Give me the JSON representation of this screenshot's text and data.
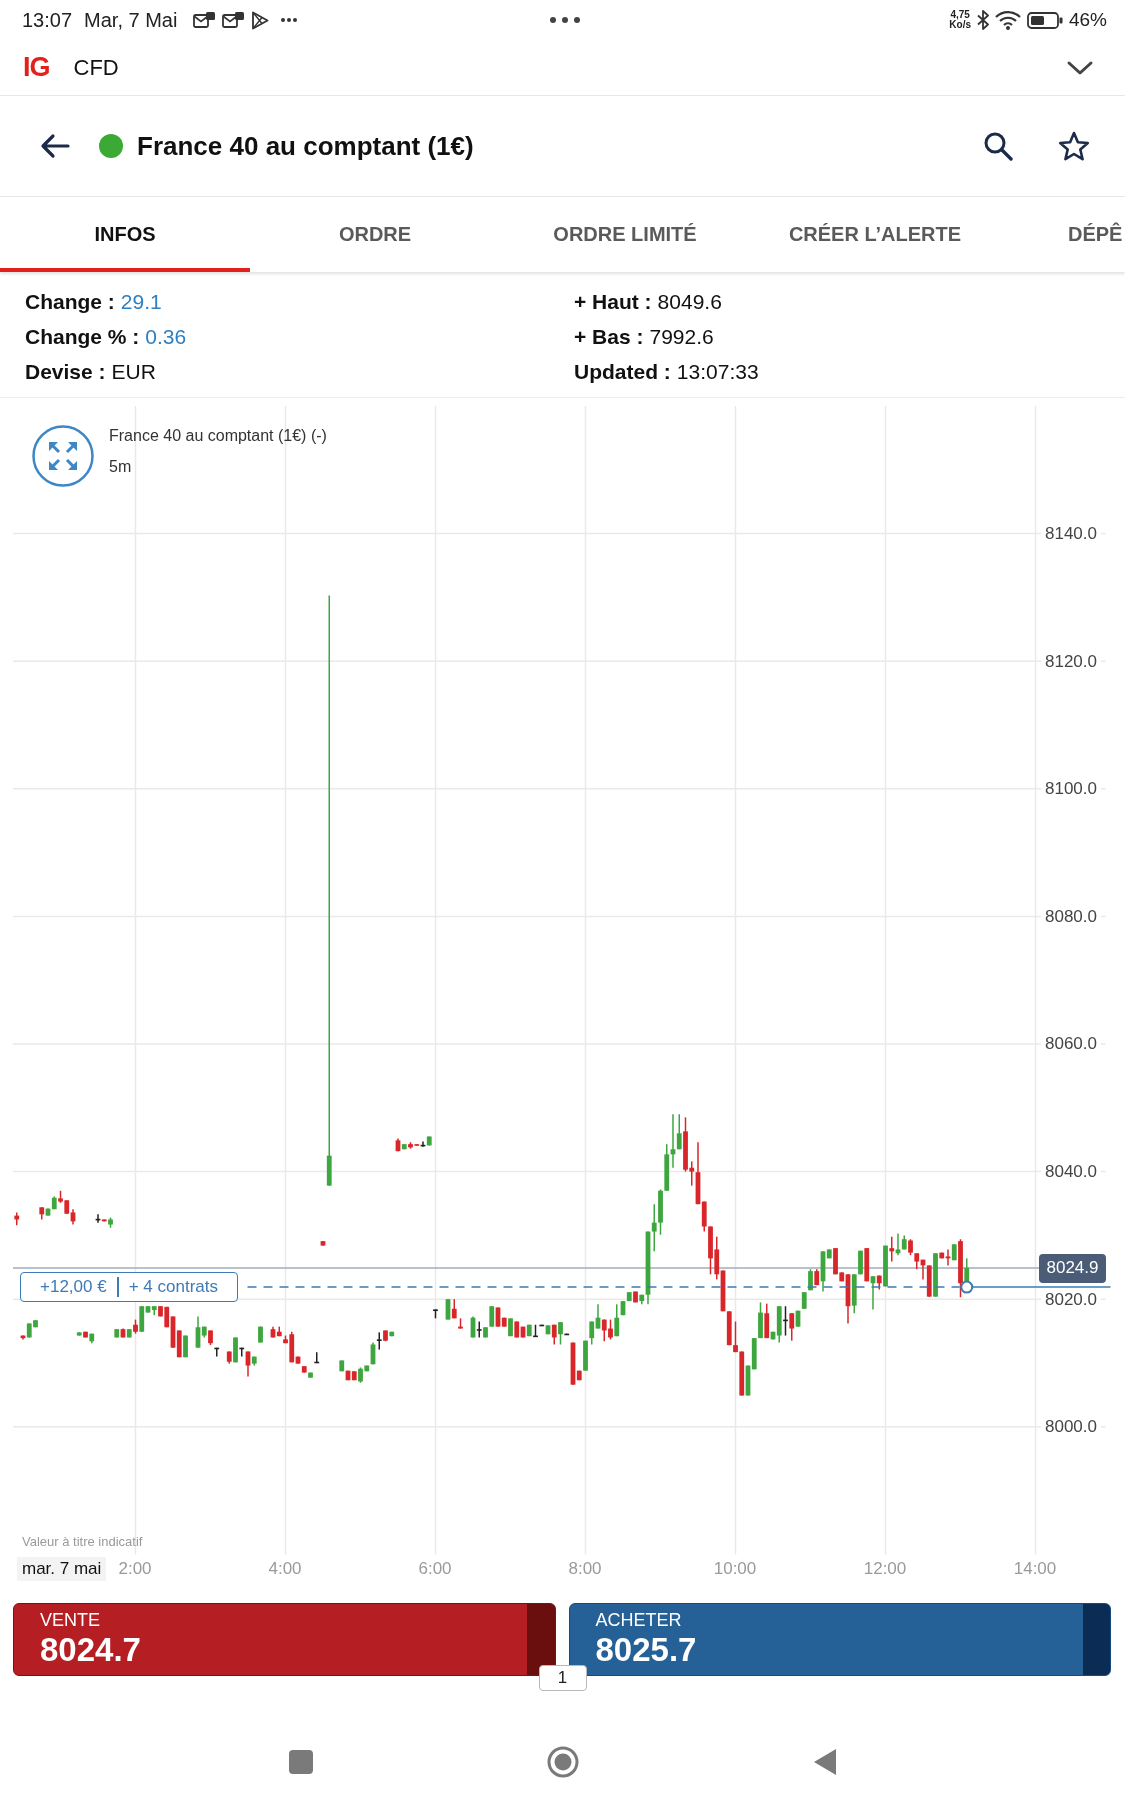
{
  "status_bar": {
    "time": "13:07",
    "date": "Mar, 7 Mai",
    "network_speed": "4,75",
    "network_unit": "Ko/s",
    "battery": "46%"
  },
  "app_bar": {
    "logo": "IG",
    "title": "CFD"
  },
  "market_header": {
    "title": "France 40 au comptant (1€)",
    "market_open": true
  },
  "tabs": [
    {
      "label": "INFOS",
      "selected": true
    },
    {
      "label": "ORDRE",
      "selected": false
    },
    {
      "label": "ORDRE LIMITÉ",
      "selected": false
    },
    {
      "label": "CRÉER L’ALERTE",
      "selected": false
    },
    {
      "label": "DÉPÊ",
      "selected": false
    }
  ],
  "info": [
    {
      "label": "Change :",
      "value": "29.1",
      "kind": "change"
    },
    {
      "label": "+ Haut :",
      "value": "8049.6",
      "kind": "plain"
    },
    {
      "label": "Change % :",
      "value": "0.36",
      "kind": "change"
    },
    {
      "label": "+ Bas :",
      "value": "7992.6",
      "kind": "plain"
    },
    {
      "label": "Devise :",
      "value": "EUR",
      "kind": "plain"
    },
    {
      "label": "Updated :",
      "value": "13:07:33",
      "kind": "plain"
    }
  ],
  "chart": {
    "interval": "5m",
    "date_label": "mar. 7 mai",
    "disclaimer": "Valeur à titre indicatif",
    "position": {
      "pnl": "+12,00 €",
      "contracts": "+ 4 contrats"
    },
    "chart_data": {
      "type": "candlestick",
      "title": "France 40 au comptant (1€) (-)",
      "grid": true,
      "xlim": [
        22,
        896
      ],
      "ylim": [
        7980,
        8160
      ],
      "yticks": [
        {
          "value": 8140,
          "label": "8140.0"
        },
        {
          "value": 8120,
          "label": "8120.0"
        },
        {
          "value": 8100,
          "label": "8100.0"
        },
        {
          "value": 8080,
          "label": "8080.0"
        },
        {
          "value": 8060,
          "label": "8060.0"
        },
        {
          "value": 8040,
          "label": "8040.0"
        },
        {
          "value": 8020,
          "label": "8020.0"
        },
        {
          "value": 8000,
          "label": "8000.0"
        }
      ],
      "xticks": [
        {
          "value": 120,
          "label": "2:00"
        },
        {
          "value": 240,
          "label": "4:00"
        },
        {
          "value": 360,
          "label": "6:00"
        },
        {
          "value": 480,
          "label": "8:00"
        },
        {
          "value": 600,
          "label": "10:00"
        },
        {
          "value": 720,
          "label": "12:00"
        },
        {
          "value": 840,
          "label": "14:00"
        }
      ],
      "ref_lines": [
        {
          "axis": "y",
          "value": 8024.9,
          "label": "8024.9",
          "color": "#a3acba"
        },
        {
          "axis": "y",
          "value": 8021.9,
          "color": "#3d7ab8"
        }
      ],
      "x": [
        25,
        30,
        35,
        40,
        45,
        50,
        55,
        60,
        65,
        70,
        75,
        80,
        85,
        90,
        95,
        100,
        105,
        110,
        115,
        120,
        125,
        130,
        135,
        140,
        145,
        150,
        155,
        160,
        170,
        175,
        180,
        185,
        195,
        200,
        205,
        210,
        215,
        220,
        230,
        235,
        240,
        245,
        250,
        255,
        260,
        265,
        270,
        275,
        285,
        290,
        295,
        300,
        305,
        310,
        315,
        320,
        325,
        330,
        335,
        340,
        345,
        350,
        355,
        360,
        370,
        375,
        380,
        390,
        395,
        400,
        405,
        410,
        415,
        420,
        425,
        430,
        435,
        440,
        445,
        450,
        455,
        460,
        465,
        470,
        475,
        480,
        485,
        490,
        495,
        500,
        505,
        510,
        515,
        520,
        525,
        530,
        535,
        540,
        545,
        550,
        555,
        560,
        565,
        570,
        575,
        580,
        585,
        590,
        595,
        600,
        605,
        610,
        615,
        620,
        625,
        630,
        635,
        640,
        645,
        650,
        655,
        660,
        665,
        670,
        675,
        680,
        685,
        690,
        695,
        700,
        705,
        710,
        715,
        720,
        725,
        730,
        735,
        740,
        745,
        750,
        755,
        760,
        765,
        770,
        775,
        780,
        785
      ],
      "ohlc": [
        [
          8033.1,
          8033.6,
          8031.6,
          8032.5
        ],
        [
          8014.3,
          8014.3,
          8013.7,
          8013.9
        ],
        [
          8014.0,
          8016.2,
          8014.0,
          8016.2
        ],
        [
          8015.6,
          8016.7,
          8015.6,
          8016.7
        ],
        [
          8034.4,
          8034.4,
          8032.5,
          8033.3
        ],
        [
          8033.1,
          8034.2,
          8033.1,
          8034.2
        ],
        [
          8034.1,
          8036.1,
          8034.1,
          8035.9
        ],
        [
          8035.8,
          8037.0,
          8035.1,
          8035.3
        ],
        [
          8035.5,
          8035.5,
          8033.4,
          8033.4
        ],
        [
          8033.6,
          8034.1,
          8031.7,
          8032.2
        ],
        [
          8014.3,
          8014.8,
          8014.3,
          8014.8
        ],
        [
          8014.9,
          8014.9,
          8014.0,
          8014.0
        ],
        [
          8013.4,
          8014.6,
          8013.1,
          8014.6
        ],
        [
          8032.6,
          8033.3,
          8032.0,
          8032.6
        ],
        [
          8032.5,
          8032.5,
          8032.2,
          8032.2
        ],
        [
          8031.7,
          8032.8,
          8031.2,
          8032.5
        ],
        [
          8014.0,
          8015.3,
          8014.0,
          8015.3
        ],
        [
          8015.3,
          8015.4,
          8014.0,
          8014.0
        ],
        [
          8014.0,
          8015.3,
          8014.0,
          8015.3
        ],
        [
          8016.0,
          8016.8,
          8014.6,
          8014.9
        ],
        [
          8014.9,
          8018.9,
          8014.9,
          8018.9
        ],
        [
          8017.9,
          8018.9,
          8017.9,
          8018.9
        ],
        [
          8018.3,
          8018.9,
          8017.5,
          8018.9
        ],
        [
          8018.9,
          8018.9,
          8017.3,
          8017.3
        ],
        [
          8018.8,
          8018.8,
          8015.6,
          8015.6
        ],
        [
          8017.3,
          8017.3,
          8012.4,
          8012.4
        ],
        [
          8015.1,
          8015.1,
          8010.9,
          8010.9
        ],
        [
          8010.9,
          8014.3,
          8010.9,
          8014.3
        ],
        [
          8012.4,
          8017.3,
          8012.4,
          8015.6
        ],
        [
          8014.3,
          8015.7,
          8014.0,
          8015.7
        ],
        [
          8015.1,
          8015.1,
          8012.8,
          8013.1
        ],
        [
          8012.4,
          8012.4,
          8011.0,
          8012.4
        ],
        [
          8011.8,
          8011.8,
          8009.9,
          8010.2
        ],
        [
          8010.1,
          8014.0,
          8010.1,
          8014.0
        ],
        [
          8012.4,
          8012.4,
          8011.0,
          8012.4
        ],
        [
          8011.8,
          8011.8,
          8007.9,
          8009.6
        ],
        [
          8009.9,
          8011.0,
          8009.6,
          8011.0
        ],
        [
          8013.2,
          8015.7,
          8013.2,
          8015.7
        ],
        [
          8015.3,
          8015.7,
          8014.0,
          8014.0
        ],
        [
          8014.9,
          8015.7,
          8014.2,
          8014.2
        ],
        [
          8013.7,
          8014.3,
          8013.1,
          8013.1
        ],
        [
          8014.5,
          8014.9,
          8010.1,
          8010.1
        ],
        [
          8011.0,
          8011.0,
          8009.9,
          8009.9
        ],
        [
          8009.5,
          8009.5,
          8008.5,
          8008.5
        ],
        [
          8007.7,
          8008.5,
          8007.7,
          8008.5
        ],
        [
          8010.2,
          8011.7,
          8010.1,
          8010.2
        ],
        [
          8029.1,
          8029.1,
          8028.4,
          8028.4
        ],
        [
          8037.8,
          8130.3,
          8037.8,
          8042.5
        ],
        [
          8008.7,
          8010.4,
          8008.7,
          8010.4
        ],
        [
          8008.8,
          8008.8,
          8007.3,
          8007.3
        ],
        [
          8008.7,
          8008.7,
          8007.3,
          8007.3
        ],
        [
          8007.1,
          8009.3,
          8006.9,
          8009.1
        ],
        [
          8008.7,
          8009.6,
          8008.7,
          8009.6
        ],
        [
          8009.8,
          8013.2,
          8009.8,
          8012.9
        ],
        [
          8013.7,
          8014.8,
          8012.1,
          8013.7
        ],
        [
          8015.1,
          8015.1,
          8013.4,
          8013.5
        ],
        [
          8014.2,
          8014.9,
          8014.2,
          8014.9
        ],
        [
          8044.9,
          8045.2,
          8043.2,
          8043.2
        ],
        [
          8043.5,
          8044.3,
          8043.5,
          8044.3
        ],
        [
          8044.3,
          8044.6,
          8043.6,
          8043.8
        ],
        [
          8044.3,
          8044.3,
          8044.1,
          8044.1
        ],
        [
          8044.2,
          8044.7,
          8043.9,
          8044.2
        ],
        [
          8044.1,
          8045.5,
          8044.1,
          8045.5
        ],
        [
          8018.4,
          8018.4,
          8017.0,
          8018.4
        ],
        [
          8016.8,
          8020.0,
          8016.8,
          8020.0
        ],
        [
          8018.5,
          8020.0,
          8017.0,
          8017.0
        ],
        [
          8015.7,
          8017.0,
          8015.4,
          8015.4
        ],
        [
          8014.0,
          8017.3,
          8014.0,
          8017.1
        ],
        [
          8015.3,
          8016.5,
          8014.0,
          8015.3
        ],
        [
          8014.0,
          8015.6,
          8014.0,
          8015.6
        ],
        [
          8015.7,
          8018.9,
          8015.7,
          8018.9
        ],
        [
          8018.7,
          8018.7,
          8015.7,
          8015.7
        ],
        [
          8017.1,
          8017.1,
          8015.7,
          8015.7
        ],
        [
          8014.2,
          8017.0,
          8014.2,
          8017.0
        ],
        [
          8016.5,
          8016.5,
          8014.0,
          8014.0
        ],
        [
          8015.7,
          8015.7,
          8014.0,
          8014.0
        ],
        [
          8014.2,
          8016.0,
          8014.2,
          8016.0
        ],
        [
          8014.3,
          8016.0,
          8014.2,
          8014.3
        ],
        [
          8016.0,
          8016.0,
          8015.9,
          8016.0
        ],
        [
          8014.5,
          8015.9,
          8014.5,
          8015.9
        ],
        [
          8016.0,
          8016.0,
          8012.9,
          8014.0
        ],
        [
          8014.5,
          8016.4,
          8012.9,
          8016.4
        ],
        [
          8014.6,
          8014.6,
          8014.5,
          8014.6
        ],
        [
          8013.2,
          8013.2,
          8006.6,
          8006.6
        ],
        [
          8008.8,
          8008.8,
          8007.3,
          8007.3
        ],
        [
          8008.8,
          8013.5,
          8008.8,
          8013.5
        ],
        [
          8013.9,
          8016.5,
          8012.9,
          8016.5
        ],
        [
          8015.4,
          8019.2,
          8015.4,
          8017.1
        ],
        [
          8016.8,
          8016.8,
          8013.4,
          8015.1
        ],
        [
          8015.4,
          8016.8,
          8013.7,
          8014.0
        ],
        [
          8014.2,
          8019.2,
          8014.2,
          8017.1
        ],
        [
          8017.5,
          8019.7,
          8017.5,
          8019.7
        ],
        [
          8019.7,
          8021.1,
          8019.7,
          8021.1
        ],
        [
          8021.2,
          8021.2,
          8019.5,
          8019.5
        ],
        [
          8019.7,
          8020.7,
          8019.2,
          8020.7
        ],
        [
          8020.7,
          8030.6,
          8019.2,
          8030.6
        ],
        [
          8030.6,
          8034.9,
          8027.5,
          8032.0
        ],
        [
          8032.0,
          8037.2,
          8030.1,
          8037.0
        ],
        [
          8037.0,
          8044.3,
          8037.0,
          8042.7
        ],
        [
          8042.7,
          8049.0,
          8040.6,
          8043.5
        ],
        [
          8043.5,
          8049.0,
          8043.5,
          8046.0
        ],
        [
          8046.3,
          8048.5,
          8040.0,
          8040.3
        ],
        [
          8040.6,
          8041.6,
          8037.8,
          8040.0
        ],
        [
          8039.9,
          8044.6,
          8034.9,
          8034.9
        ],
        [
          8035.3,
          8035.3,
          8030.6,
          8031.4
        ],
        [
          8031.4,
          8031.4,
          8023.9,
          8026.4
        ],
        [
          8027.8,
          8029.8,
          8023.1,
          8023.9
        ],
        [
          8024.5,
          8024.5,
          8018.1,
          8018.1
        ],
        [
          8018.1,
          8018.1,
          8012.8,
          8012.8
        ],
        [
          8012.8,
          8016.5,
          8011.7,
          8011.7
        ],
        [
          8011.8,
          8011.8,
          8004.9,
          8004.9
        ],
        [
          8004.9,
          8009.6,
          8004.9,
          8009.6
        ],
        [
          8009.0,
          8013.9,
          8009.0,
          8013.9
        ],
        [
          8013.9,
          8019.5,
          8013.9,
          8017.9
        ],
        [
          8017.8,
          8019.3,
          8013.9,
          8013.9
        ],
        [
          8013.7,
          8014.9,
          8013.7,
          8014.9
        ],
        [
          8014.3,
          8018.9,
          8013.2,
          8018.9
        ],
        [
          8016.8,
          8018.9,
          8014.3,
          8016.8
        ],
        [
          8017.8,
          8017.8,
          8013.5,
          8015.4
        ],
        [
          8015.7,
          8018.2,
          8015.7,
          8018.2
        ],
        [
          8018.5,
          8021.1,
          8018.5,
          8021.1
        ],
        [
          8021.4,
          8024.7,
          8021.4,
          8024.4
        ],
        [
          8024.4,
          8024.7,
          8022.2,
          8022.2
        ],
        [
          8022.8,
          8027.5,
          8021.2,
          8027.5
        ],
        [
          8026.4,
          8027.8,
          8026.4,
          8027.8
        ],
        [
          8028.0,
          8028.0,
          8023.9,
          8023.9
        ],
        [
          8024.2,
          8024.2,
          8022.8,
          8022.8
        ],
        [
          8023.9,
          8023.9,
          8016.2,
          8018.9
        ],
        [
          8019.0,
          8023.9,
          8017.8,
          8023.9
        ],
        [
          8023.9,
          8027.6,
          8023.9,
          8027.6
        ],
        [
          8028.0,
          8028.0,
          8022.8,
          8022.8
        ],
        [
          8022.5,
          8023.6,
          8018.4,
          8023.6
        ],
        [
          8023.7,
          8023.7,
          8021.5,
          8022.5
        ],
        [
          8022.0,
          8028.4,
          8022.0,
          8028.4
        ],
        [
          8028.0,
          8029.8,
          8025.9,
          8027.5
        ],
        [
          8027.2,
          8030.3,
          8026.9,
          8027.8
        ],
        [
          8027.8,
          8030.0,
          8027.8,
          8029.4
        ],
        [
          8029.2,
          8029.4,
          8026.9,
          8027.3
        ],
        [
          8027.2,
          8027.2,
          8024.7,
          8025.9
        ],
        [
          8026.2,
          8026.2,
          8023.1,
          8025.3
        ],
        [
          8025.3,
          8025.3,
          8020.4,
          8020.4
        ],
        [
          8020.4,
          8027.2,
          8020.4,
          8027.2
        ],
        [
          8027.3,
          8027.3,
          8026.4,
          8026.4
        ],
        [
          8026.7,
          8027.8,
          8025.3,
          8026.4
        ],
        [
          8026.1,
          8028.6,
          8026.1,
          8028.6
        ],
        [
          8029.1,
          8029.4,
          8020.3,
          8022.5
        ],
        [
          8022.8,
          8026.4,
          8022.8,
          8024.9
        ]
      ]
    }
  },
  "trade_buttons": [
    {
      "kind": "sell",
      "label": "VENTE",
      "price": "8024.7"
    },
    {
      "kind": "buy",
      "label": "ACHETER",
      "price": "8025.7"
    }
  ],
  "quantity": "1"
}
